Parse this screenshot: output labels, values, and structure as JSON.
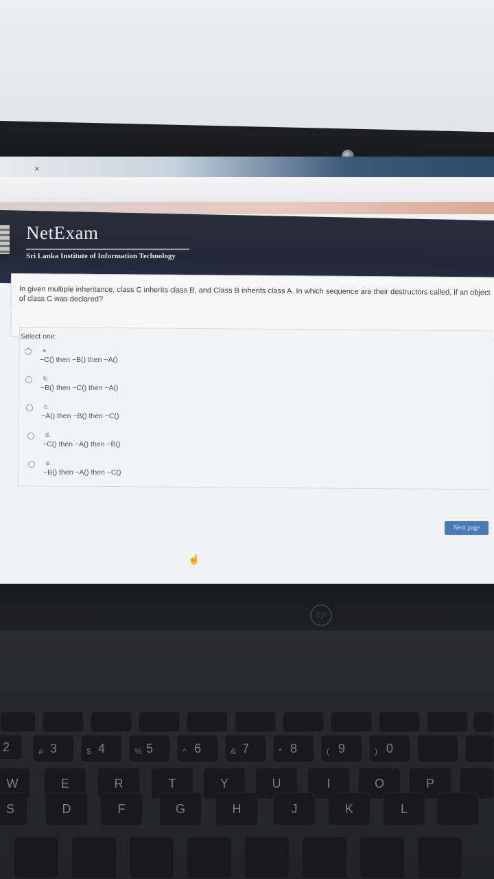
{
  "browser": {
    "tab_close_glyph": "×",
    "reload_icon": "reload-icon",
    "info_icon": "info-icon",
    "page_icon": "page-icon"
  },
  "header": {
    "app_name": "NetExam",
    "institute": "Sri Lanka Institute of Information Technology"
  },
  "question": {
    "text": "In given multiple inheritance, class C inherits class B, and Class B inherits class A. In which sequence are their destructors called, if an object of class C was declared?",
    "select_label": "Select one:",
    "options": [
      {
        "letter": "a.",
        "text": "~C() then ~B() then ~A()"
      },
      {
        "letter": "b.",
        "text": "~B() then ~C() then ~A()"
      },
      {
        "letter": "c.",
        "text": "~A() then ~B() then ~C()"
      },
      {
        "letter": "d.",
        "text": "~C() then ~A() then ~B()"
      },
      {
        "letter": "e.",
        "text": "~B() then ~A() then ~C()"
      }
    ]
  },
  "navigation": {
    "next_label": "Next page"
  },
  "laptop": {
    "brand": "hp",
    "number_row": [
      {
        "main": "2",
        "sym": ""
      },
      {
        "main": "3",
        "sym": "#"
      },
      {
        "main": "4",
        "sym": "$"
      },
      {
        "main": "5",
        "sym": "%"
      },
      {
        "main": "6",
        "sym": "^"
      },
      {
        "main": "7",
        "sym": "&"
      },
      {
        "main": "8",
        "sym": "*"
      },
      {
        "main": "9",
        "sym": "("
      },
      {
        "main": "0",
        "sym": ")"
      }
    ],
    "top_letters": [
      "W",
      "E",
      "R",
      "T",
      "Y",
      "U",
      "I",
      "O",
      "P"
    ],
    "home_letters": [
      "S",
      "D",
      "F",
      "G",
      "H",
      "J",
      "K",
      "L"
    ]
  }
}
